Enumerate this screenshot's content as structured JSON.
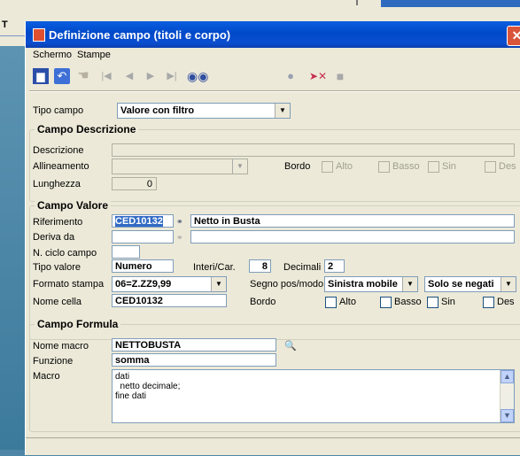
{
  "background": {
    "fragment_label": "T"
  },
  "window": {
    "title": "Definizione campo (titoli e corpo)",
    "close_glyph": "✕"
  },
  "menu": [
    {
      "label": "Schermo"
    },
    {
      "label": "Stampe"
    }
  ],
  "toolbar": {
    "icons": [
      "save-icon",
      "back-icon",
      "hand-icon",
      "first-icon",
      "prev-icon",
      "next-icon",
      "last-icon",
      "binoculars-icon",
      "magnifier-icon",
      "delete-icon",
      "stop-icon"
    ],
    "glyphs": {
      "save": "💾",
      "back": "↶",
      "hand": "☚",
      "first": "|◀",
      "prev": "◀",
      "next": "▶",
      "last": "▶|",
      "binoculars": "👓",
      "magnifier": "🔍",
      "delete": "➤✕",
      "stop": "■"
    }
  },
  "tipo_campo": {
    "label": "Tipo campo",
    "value": "Valore con filtro"
  },
  "campo_descrizione": {
    "title": "Campo Descrizione",
    "descrizione_label": "Descrizione",
    "descrizione_value": "",
    "allineamento_label": "Allineamento",
    "allineamento_value": "",
    "bordo_label": "Bordo",
    "alto_label": "Alto",
    "basso_label": "Basso",
    "sin_label": "Sin",
    "des_label": "Des",
    "lunghezza_label": "Lunghezza",
    "lunghezza_value": "0"
  },
  "campo_valore": {
    "title": "Campo Valore",
    "riferimento_label": "Riferimento",
    "riferimento_value": "CED10132",
    "riferimento_desc": "Netto in Busta",
    "deriva_label": "Deriva da",
    "deriva_value": "",
    "deriva_desc": "",
    "ciclo_label": "N. ciclo campo",
    "ciclo_value": "",
    "tipo_label": "Tipo valore",
    "tipo_value": "Numero",
    "interi_label": "Interi/Car.",
    "interi_value": "8",
    "decimali_label": "Decimali",
    "decimali_value": "2",
    "formato_label": "Formato stampa",
    "formato_value": "06=Z.ZZ9,99",
    "segno_label": "Segno pos/modo",
    "segno_value": "Sinistra mobile",
    "segno_mode": "Solo se negati",
    "nome_label": "Nome cella",
    "nome_value": "CED10132",
    "bordo_label": "Bordo",
    "alto_label": "Alto",
    "basso_label": "Basso",
    "sin_label": "Sin",
    "des_label": "Des"
  },
  "campo_formula": {
    "title": "Campo Formula",
    "macro_name_label": "Nome macro",
    "macro_name_value": "NETTOBUSTA",
    "funzione_label": "Funzione",
    "funzione_value": "somma",
    "macro_label": "Macro",
    "macro_lines": [
      "dati",
      "  netto decimale;",
      "fine dati"
    ]
  },
  "colors": {
    "title_bar": "#0a4fd0",
    "selection": "#316ac5",
    "background": "#4d86a6",
    "window": "#ece9d8"
  }
}
